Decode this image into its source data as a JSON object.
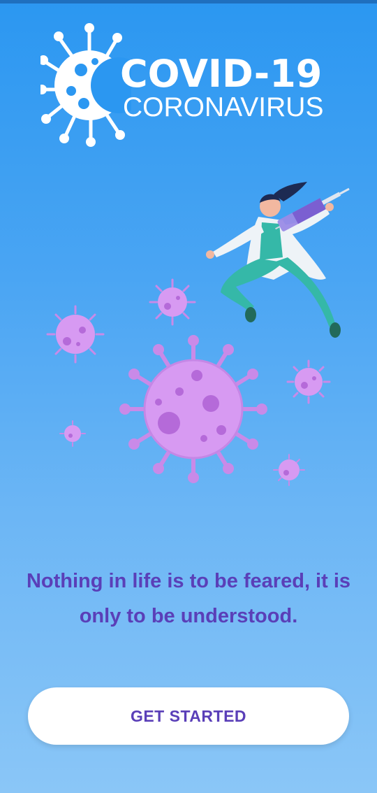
{
  "logo": {
    "title": "COVID-19",
    "subtitle": "CORONAVIRUS",
    "mark_icon": "virus-icon"
  },
  "illustration": {
    "subject": "doctor-with-syringe-and-viruses",
    "virus_color": "#d79af2"
  },
  "quote": {
    "line1": "Nothing in life is to be feared, it is",
    "line2": "only to be understood."
  },
  "cta": {
    "label": "GET STARTED"
  },
  "colors": {
    "background_top": "#2b97f1",
    "background_bottom": "#8ac6f7",
    "accent_purple": "#5a3fb8",
    "button_bg": "#ffffff"
  }
}
